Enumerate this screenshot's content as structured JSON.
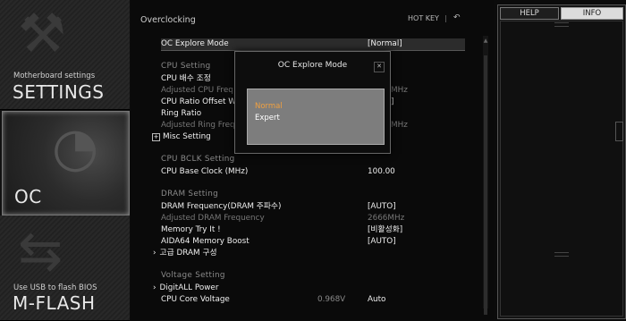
{
  "left_menu": {
    "settings": {
      "subtitle": "Motherboard settings",
      "title": "SETTINGS"
    },
    "oc": {
      "title": "OC"
    },
    "mflash": {
      "subtitle": "Use USB to flash BIOS",
      "title": "M-FLASH"
    }
  },
  "header": {
    "title": "Overclocking",
    "hotkey_label": "HOT KEY",
    "separator": "|",
    "back_icon": "undo-arrow-icon"
  },
  "rows": {
    "oc_explore": {
      "label": "OC Explore Mode",
      "value": "[Normal]"
    },
    "cpu_setting": "CPU Setting",
    "cpu_ratio": {
      "label": "CPU 배수 조정",
      "value": ""
    },
    "adj_cpu_freq": {
      "label": "Adjusted CPU Freq",
      "value": "MHz"
    },
    "cpu_ratio_offset": {
      "label": "CPU Ratio Offset W",
      "value": "]"
    },
    "ring_ratio": {
      "label": "Ring Ratio",
      "value": ""
    },
    "adj_ring_freq": {
      "label": "Adjusted Ring Freq",
      "value": "MHz"
    },
    "misc_setting": {
      "label": "Misc Setting"
    },
    "cpu_bclk_setting": "CPU BCLK Setting",
    "cpu_base_clock": {
      "label": "CPU Base Clock (MHz)",
      "value": "100.00"
    },
    "dram_setting": "DRAM Setting",
    "dram_freq": {
      "label": "DRAM Frequency(DRAM 주파수)",
      "value": "[AUTO]"
    },
    "adj_dram_freq": {
      "label": "Adjusted DRAM Frequency",
      "value": "2666MHz"
    },
    "memory_try": {
      "label": "Memory Try It !",
      "value": "[비활성화]"
    },
    "aida64": {
      "label": "AIDA64 Memory Boost",
      "value": "[AUTO]"
    },
    "adv_dram": {
      "label": "고급 DRAM 구성"
    },
    "voltage_setting": "Voltage Setting",
    "digitall": {
      "label": "DigitALL Power"
    },
    "cpu_core_voltage": {
      "label": "CPU Core Voltage",
      "reading": "0.968V",
      "value": "Auto"
    }
  },
  "right_panel": {
    "help_tab": "HELP",
    "info_tab": "INFO",
    "active_tab": "INFO"
  },
  "dialog": {
    "title": "OC Explore Mode",
    "close_icon": "close-icon",
    "options": [
      "Normal",
      "Expert"
    ],
    "selected": "Normal"
  },
  "colors": {
    "selected_option": "#f0a040",
    "background": "#0b0b0b"
  }
}
